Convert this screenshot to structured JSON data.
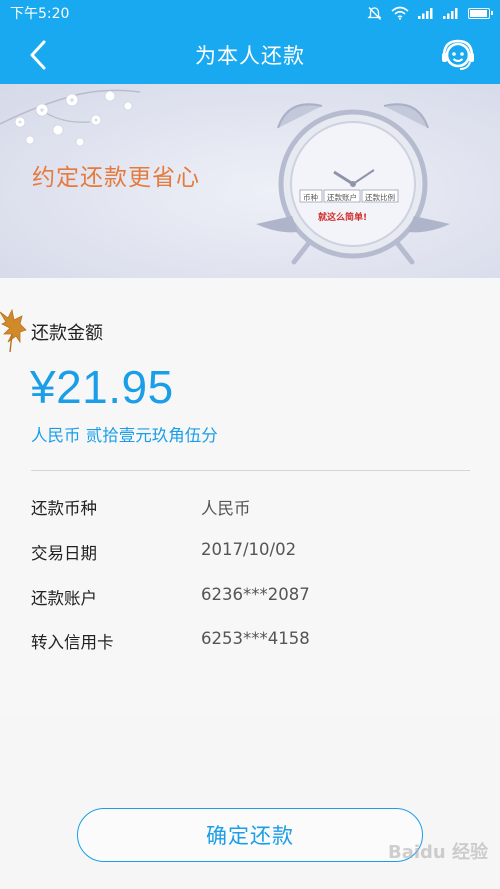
{
  "status_bar": {
    "time": "下午5:20"
  },
  "header": {
    "title": "为本人还款",
    "back_icon": "chevron-left-icon",
    "service_icon": "customer-service-icon"
  },
  "banner": {
    "slogan": "约定还款更省心",
    "clock_tags": [
      "币种",
      "还款账户",
      "还款比例"
    ],
    "clock_text": "就这么简单!"
  },
  "amount": {
    "label": "还款金额",
    "value": "¥21.95",
    "words": "人民币 贰拾壹元玖角伍分"
  },
  "details": [
    {
      "key": "还款币种",
      "value": "人民币"
    },
    {
      "key": "交易日期",
      "value": "2017/10/02"
    },
    {
      "key": "还款账户",
      "value": "6236***2087"
    },
    {
      "key": "转入信用卡",
      "value": "6253***4158"
    }
  ],
  "confirm_button": {
    "label": "确定还款"
  },
  "watermark": "Baidu 经验",
  "colors": {
    "brand": "#19a9f0",
    "accent": "#1a9ee8",
    "slogan": "#e47a3d"
  }
}
